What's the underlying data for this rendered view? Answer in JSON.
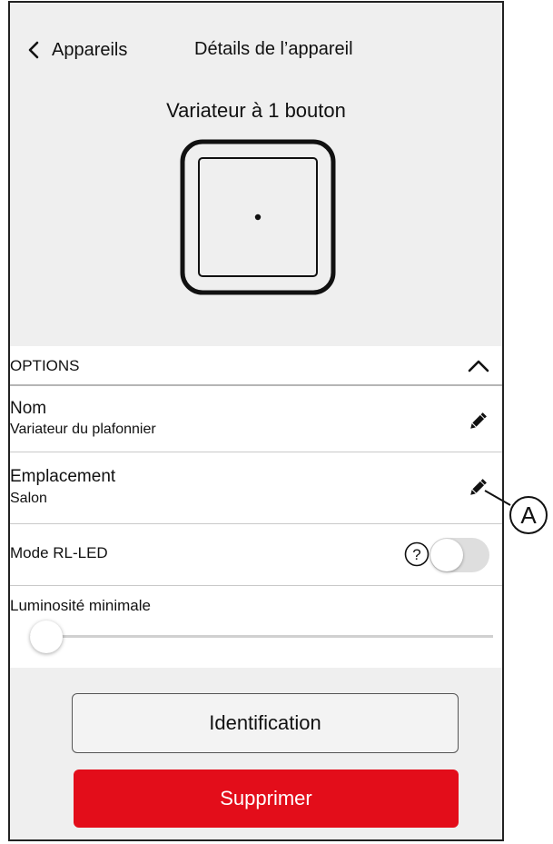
{
  "header": {
    "back_label": "Appareils",
    "title": "Détails de l’appareil"
  },
  "device": {
    "name": "Variateur à 1 bouton"
  },
  "options": {
    "title": "OPTIONS",
    "name": {
      "label": "Nom",
      "value": "Variateur du plafonnier"
    },
    "location": {
      "label": "Emplacement",
      "value": "Salon"
    },
    "mode": {
      "label": "Mode RL-LED",
      "enabled": false
    },
    "min_brightness": {
      "label": "Luminosité minimale",
      "level_percent": 0
    }
  },
  "buttons": {
    "identify": "Identification",
    "delete": "Supprimer"
  },
  "callout": {
    "letter": "A"
  },
  "icons": [
    "chevron-left-icon",
    "chevron-up-icon",
    "pencil-icon",
    "help-circle-icon"
  ],
  "colors": {
    "background": "#efefef",
    "delete_button": "#e30d1a",
    "toggle_off": "#dedede"
  }
}
